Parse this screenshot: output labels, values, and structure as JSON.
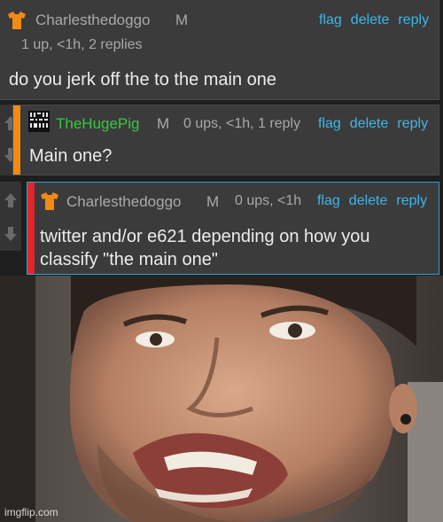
{
  "comments": [
    {
      "username": "Charlesthedoggo",
      "flair": "M",
      "meta": "1 up, <1h, 2 replies",
      "text": "do you jerk off the to the main one",
      "actions": [
        "flag",
        "delete",
        "reply"
      ],
      "avatar_icon": "shirt-icon"
    },
    {
      "username": "TheHugePig",
      "flair": "M",
      "meta": "0 ups, <1h, 1 reply",
      "text": "Main one?",
      "actions": [
        "flag",
        "delete",
        "reply"
      ],
      "avatar_icon": "pixel-avatar-icon"
    },
    {
      "username": "Charlesthedoggo",
      "flair": "M",
      "meta": "0 ups, <1h",
      "text_line1": "twitter and/or e621 depending on how you",
      "text_line2": "classify \"the main one\"",
      "actions": [
        "flag",
        "delete",
        "reply"
      ],
      "avatar_icon": "shirt-icon"
    }
  ],
  "watermark": "imgflip.com",
  "colors": {
    "link": "#3eb6ea",
    "green_username": "#37c83f",
    "orange_bar": "#f28a13",
    "red_bar": "#e0262d",
    "highlight_border": "#2ea3d6"
  }
}
